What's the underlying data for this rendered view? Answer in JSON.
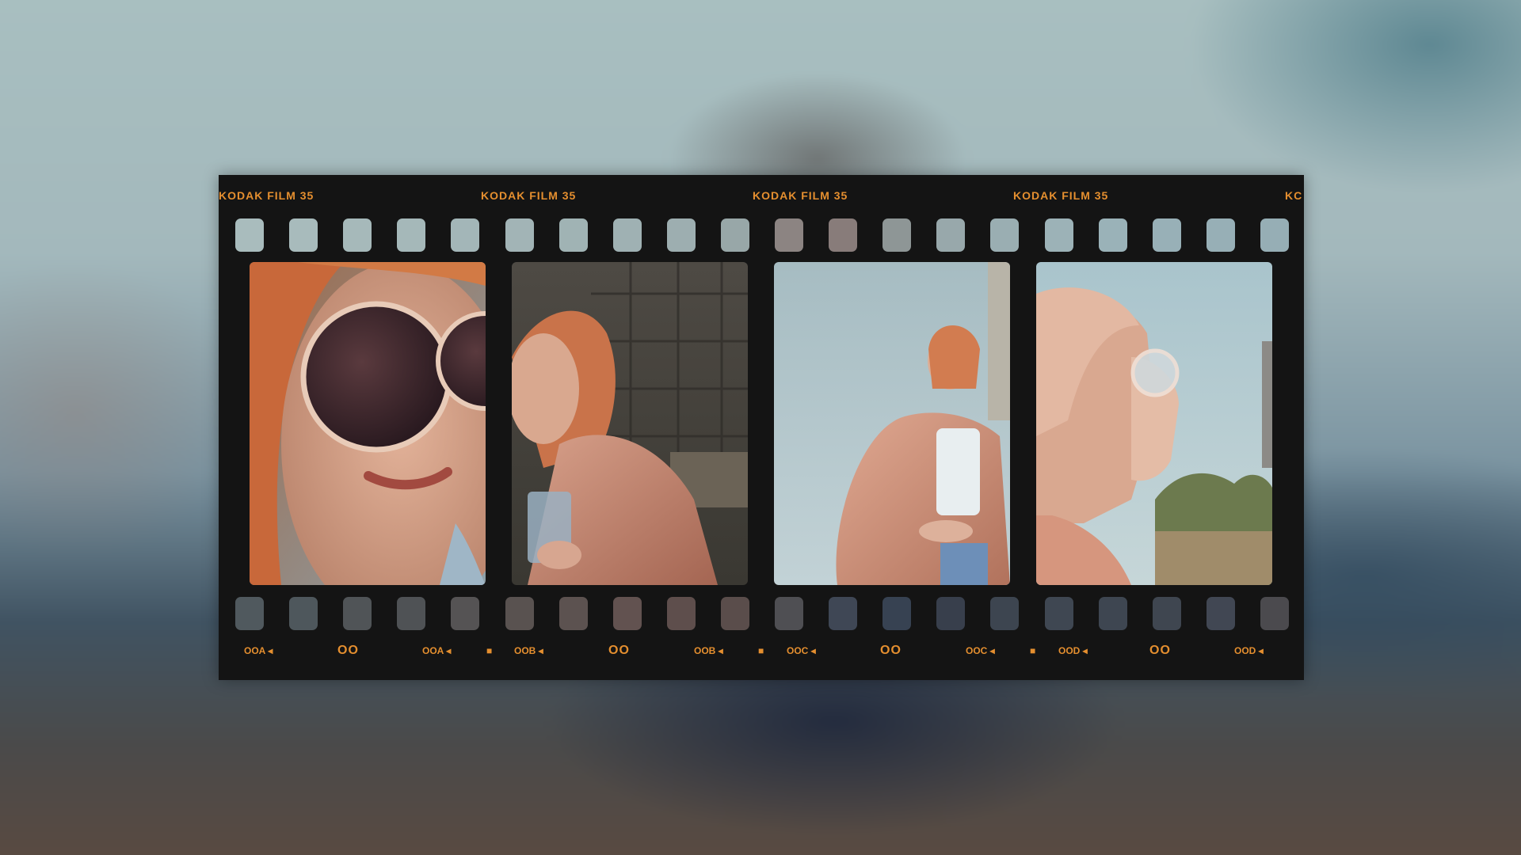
{
  "film": {
    "brand_label": "KODAK FILM 35",
    "brand_label_cut": "KC",
    "edge_codes": {
      "a1": "OOA ◂",
      "oo1": "OO",
      "a2": "OOA ◂",
      "dot1": "■",
      "b1": "OOB ◂",
      "oo2": "OO",
      "b2": "OOB ◂",
      "dot2": "■",
      "c1": "OOC ◂",
      "oo3": "OO",
      "c2": "OOC ◂",
      "dot3": "■",
      "d1": "OOD ◂",
      "oo4": "OO",
      "d2": "OOD ◂"
    },
    "accent_color": "#e58f2f",
    "base_color": "#141414"
  },
  "frames": [
    {
      "subject": "close-up portrait with round sunglasses"
    },
    {
      "subject": "woman in pink satin jacket holding a drink by a brick wall"
    },
    {
      "subject": "low-angle shot of woman in pink jacket against sky"
    },
    {
      "subject": "profile of woman with sunglasses against sky and trees"
    }
  ]
}
